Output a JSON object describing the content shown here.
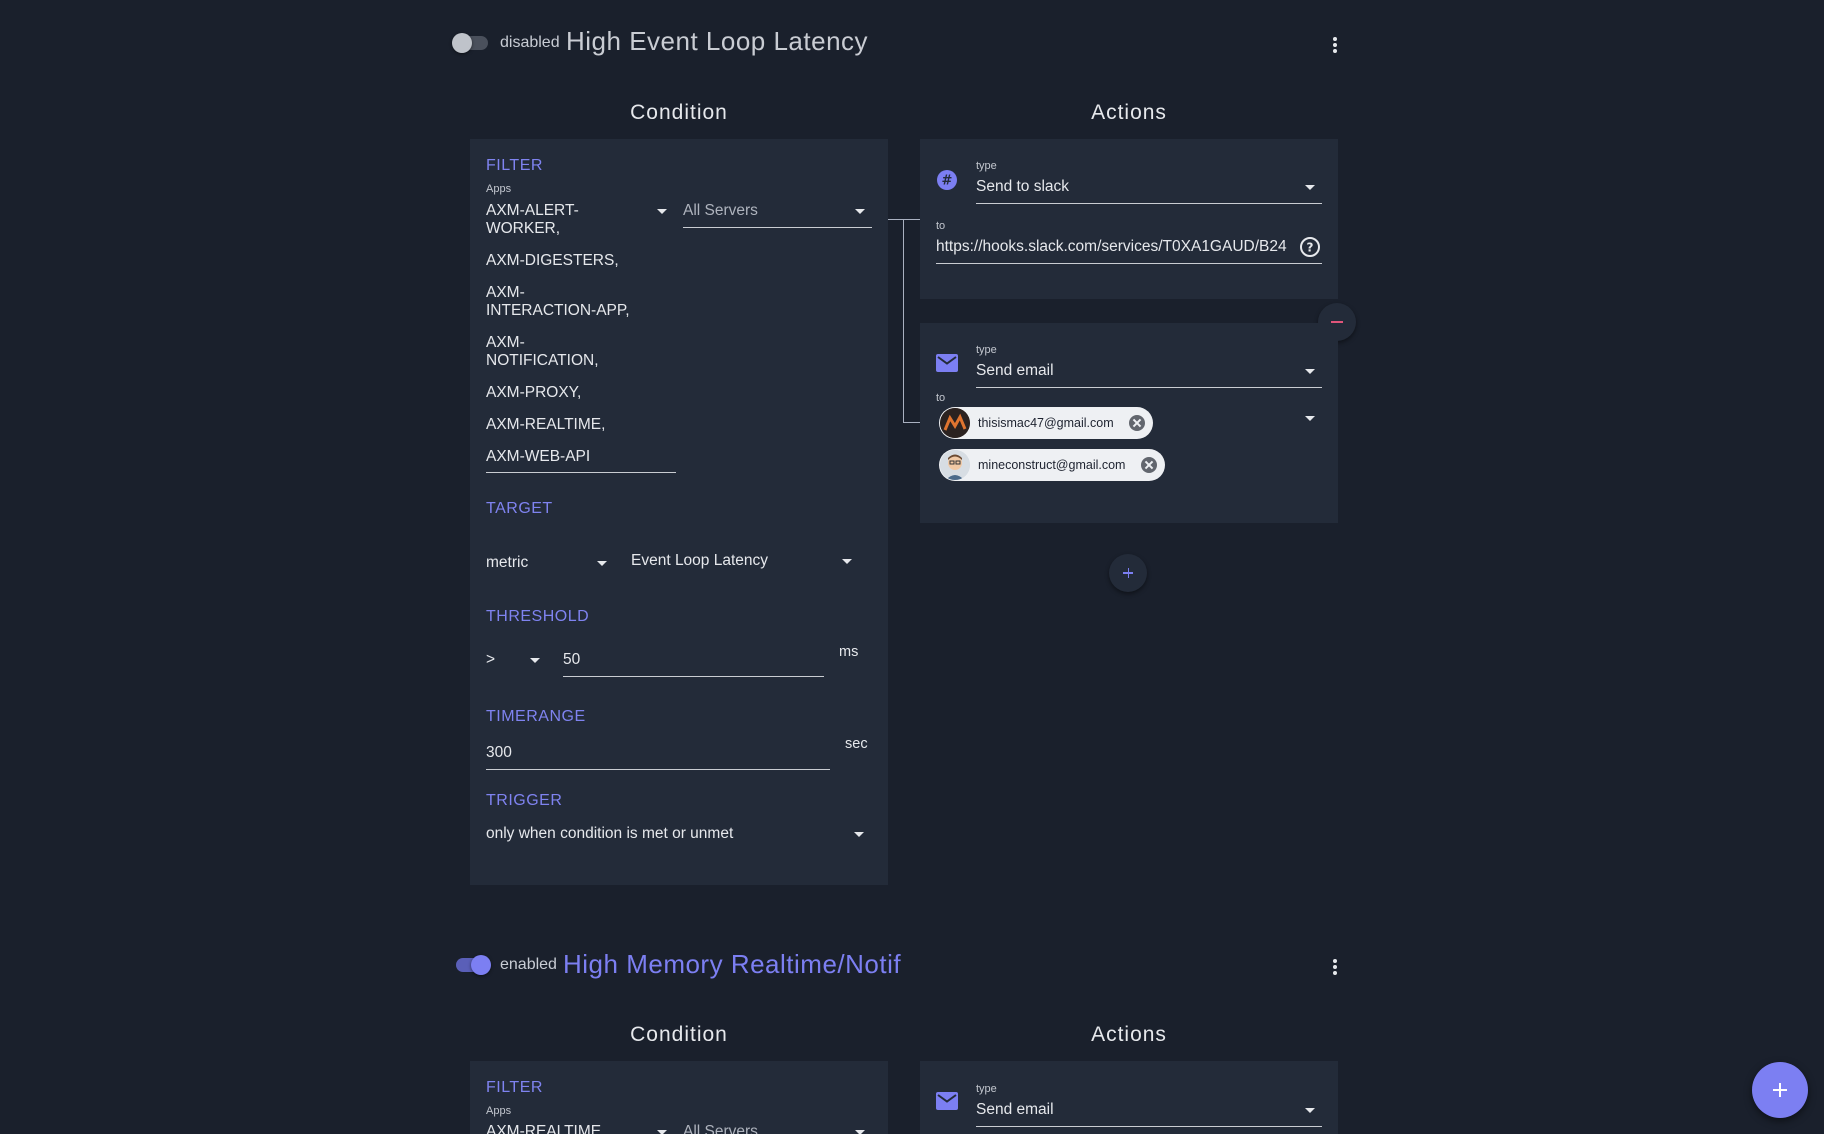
{
  "alerts": [
    {
      "state_label": "disabled",
      "enabled": false,
      "title": "High Event Loop Latency",
      "condition_heading": "Condition",
      "actions_heading": "Actions",
      "filter": {
        "heading": "FILTER",
        "apps_label": "Apps",
        "apps": [
          "AXM-ALERT-WORKER,",
          "AXM-DIGESTERS,",
          "AXM-INTERACTION-APP,",
          "AXM-NOTIFICATION,",
          "AXM-PROXY,",
          "AXM-REALTIME,",
          "AXM-WEB-API"
        ],
        "app_lines": [
          "AXM-ALERT-",
          "WORKER,",
          "AXM-DIGESTERS,",
          "AXM-",
          "INTERACTION-APP,",
          "AXM-",
          "NOTIFICATION,",
          "AXM-PROXY,",
          "AXM-REALTIME,",
          "AXM-WEB-API"
        ],
        "servers": "All Servers"
      },
      "target": {
        "heading": "TARGET",
        "kind": "metric",
        "metric": "Event Loop Latency"
      },
      "threshold": {
        "heading": "THRESHOLD",
        "operator": ">",
        "value": "50",
        "unit": "ms"
      },
      "timerange": {
        "heading": "TIMERANGE",
        "value": "300",
        "unit": "sec"
      },
      "trigger": {
        "heading": "TRIGGER",
        "value": "only when condition is met or unmet"
      },
      "actions": [
        {
          "icon": "slack-icon",
          "type_label": "type",
          "type": "Send to slack",
          "to_label": "to",
          "to": "https://hooks.slack.com/services/T0XA1GAUD/B24",
          "help_icon": "help-circle-icon"
        },
        {
          "icon": "mail-icon",
          "type_label": "type",
          "type": "Send email",
          "to_label": "to",
          "recipients": [
            "thisismac47@gmail.com",
            "mineconstruct@gmail.com"
          ]
        }
      ]
    },
    {
      "state_label": "enabled",
      "enabled": true,
      "title": "High Memory Realtime/Notif",
      "condition_heading": "Condition",
      "actions_heading": "Actions",
      "filter": {
        "heading": "FILTER",
        "apps_label": "Apps",
        "first_app_partial": "AXM-REALTIME,",
        "servers": "All Servers"
      },
      "actions": [
        {
          "icon": "mail-icon",
          "type_label": "type",
          "type": "Send email"
        }
      ]
    }
  ],
  "colors": {
    "background": "#1a202c",
    "panel": "#232b39",
    "accent": "#7c7ff2",
    "remove": "#e0557a"
  }
}
